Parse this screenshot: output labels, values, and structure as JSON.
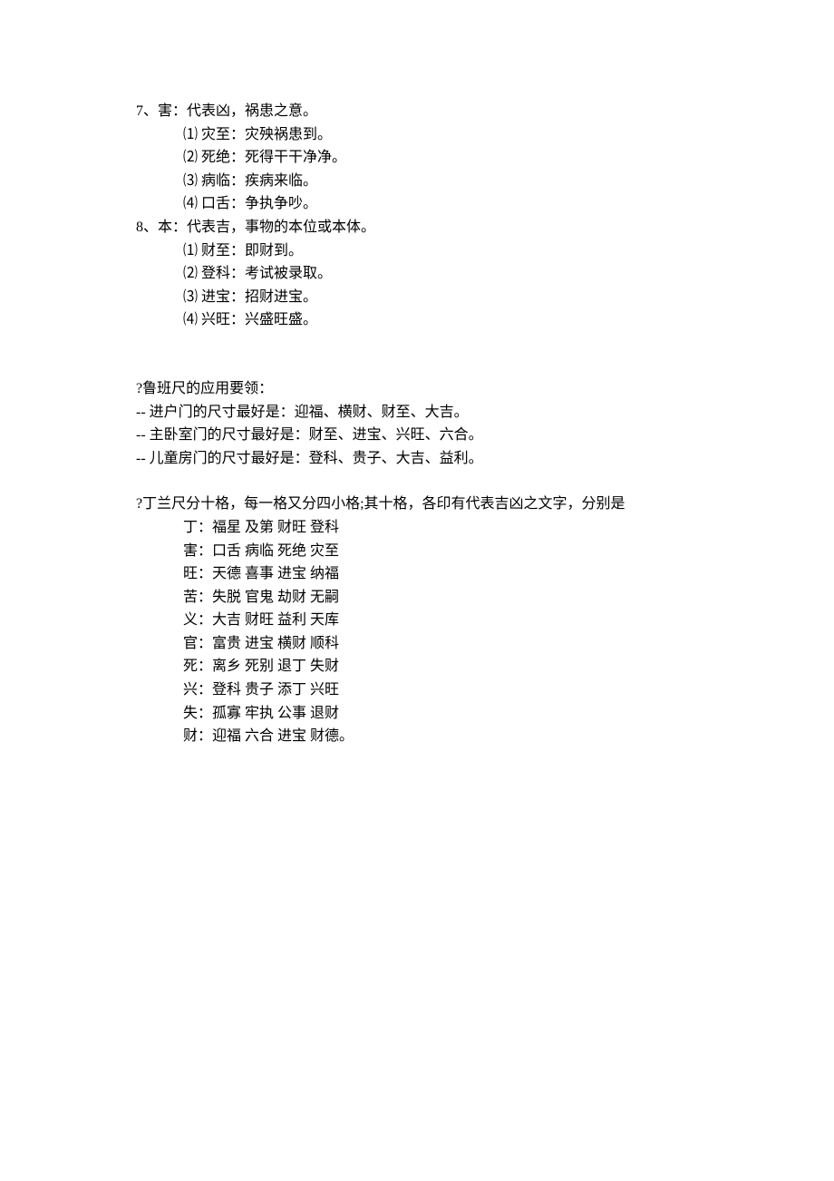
{
  "section7": {
    "header": "7、害：代表凶，祸患之意。",
    "items": [
      "⑴ 灾至：灾殃祸患到。",
      "⑵ 死绝：死得干干净净。",
      "⑶ 病临：疾病来临。",
      "⑷ 口舌：争执争吵。"
    ]
  },
  "section8": {
    "header": "8、本：代表吉，事物的本位或本体。",
    "items": [
      "⑴ 财至：即财到。",
      "⑵ 登科：考试被录取。",
      "⑶ 进宝：招财进宝。",
      "⑷ 兴旺：兴盛旺盛。"
    ]
  },
  "application": {
    "title": "?鲁班尺的应用要领：",
    "lines": [
      "-- 进户门的尺寸最好是：迎福、横财、财至、大吉。",
      "-- 主卧室门的尺寸最好是：财至、进宝、兴旺、六合。",
      "-- 儿童房门的尺寸最好是：登科、贵子、大吉、益利。"
    ]
  },
  "dinglan": {
    "intro": "?丁兰尺分十格，每一格又分四小格;其十格，各印有代表吉凶之文字，分别是",
    "items": [
      "丁：福星  及第  财旺  登科",
      "害：口舌  病临  死绝  灾至",
      "旺：天德  喜事  进宝  纳福",
      "苦：失脱  官鬼  劫财  无嗣",
      "义：大吉  财旺  益利  天库",
      "官：富贵  进宝  横财  顺科",
      "死：离乡  死别  退丁  失财",
      "兴：登科  贵子  添丁  兴旺",
      "失：孤寡  牢执  公事  退财",
      "财：迎福  六合  进宝  财德。"
    ]
  }
}
